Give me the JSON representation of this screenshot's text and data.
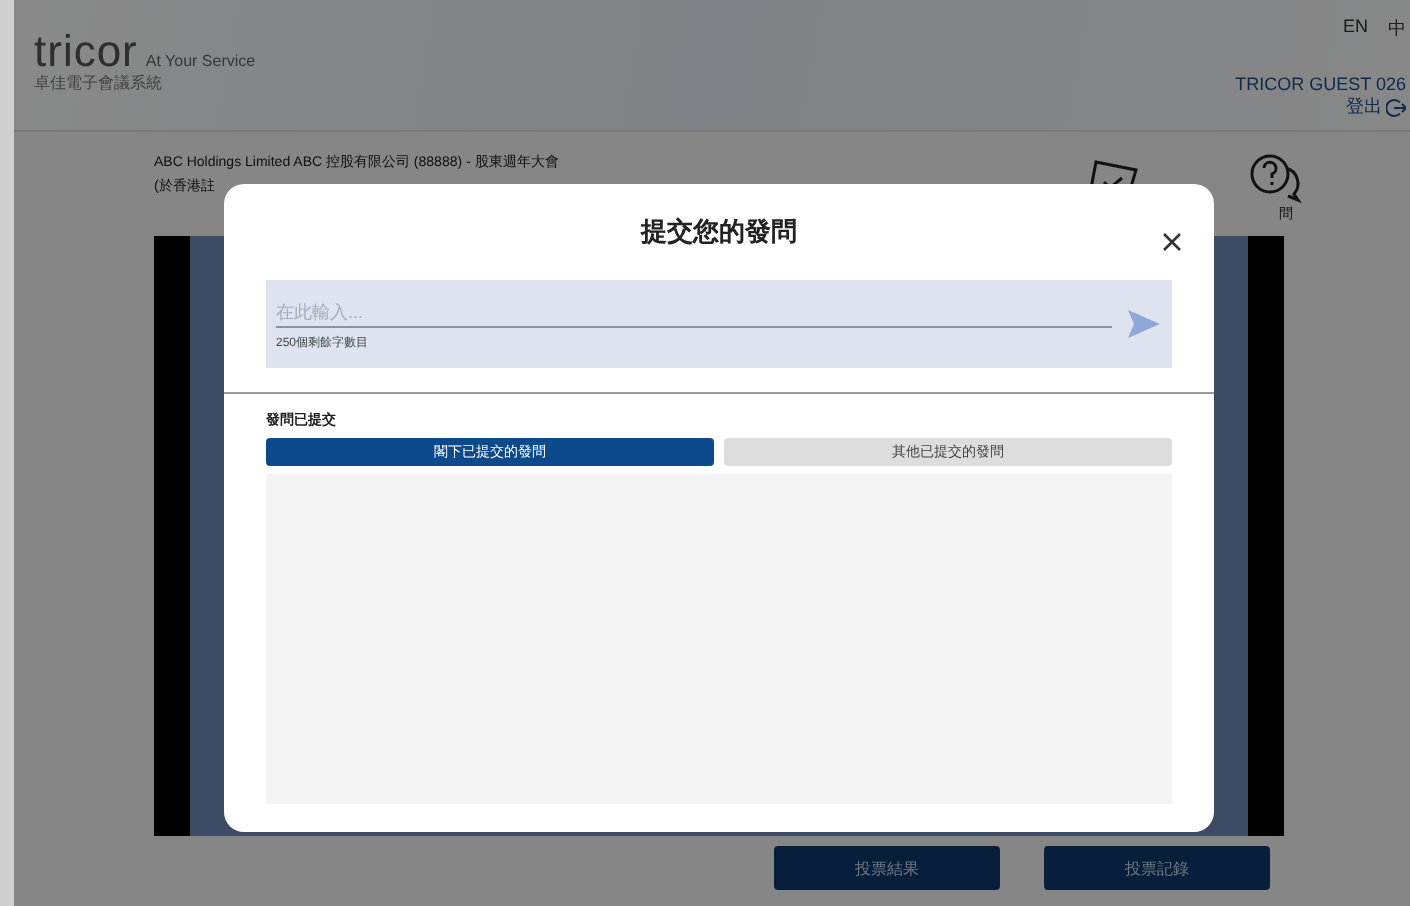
{
  "header": {
    "brand": "tricor",
    "tagline": "At Your Service",
    "subtitle": "卓佳電子會議系統",
    "languages": [
      "EN",
      "中"
    ],
    "user": "TRICOR GUEST 026",
    "logout": "登出"
  },
  "meeting": {
    "title": "ABC Holdings Limited ABC 控股有限公司 (88888) - 股東週年大會",
    "subtitle": "(於香港註"
  },
  "question_icon_label": "問",
  "modal": {
    "title": "提交您的發問",
    "input": {
      "placeholder": "在此輸入..."
    },
    "counter": "250個剩餘字數目",
    "section_title": "發問已提交",
    "tabs": [
      {
        "label": "閣下已提交的發問",
        "selected": true
      },
      {
        "label": "其他已提交的發問",
        "selected": false
      }
    ]
  },
  "buttons": [
    "投票結果",
    "投票記錄"
  ]
}
